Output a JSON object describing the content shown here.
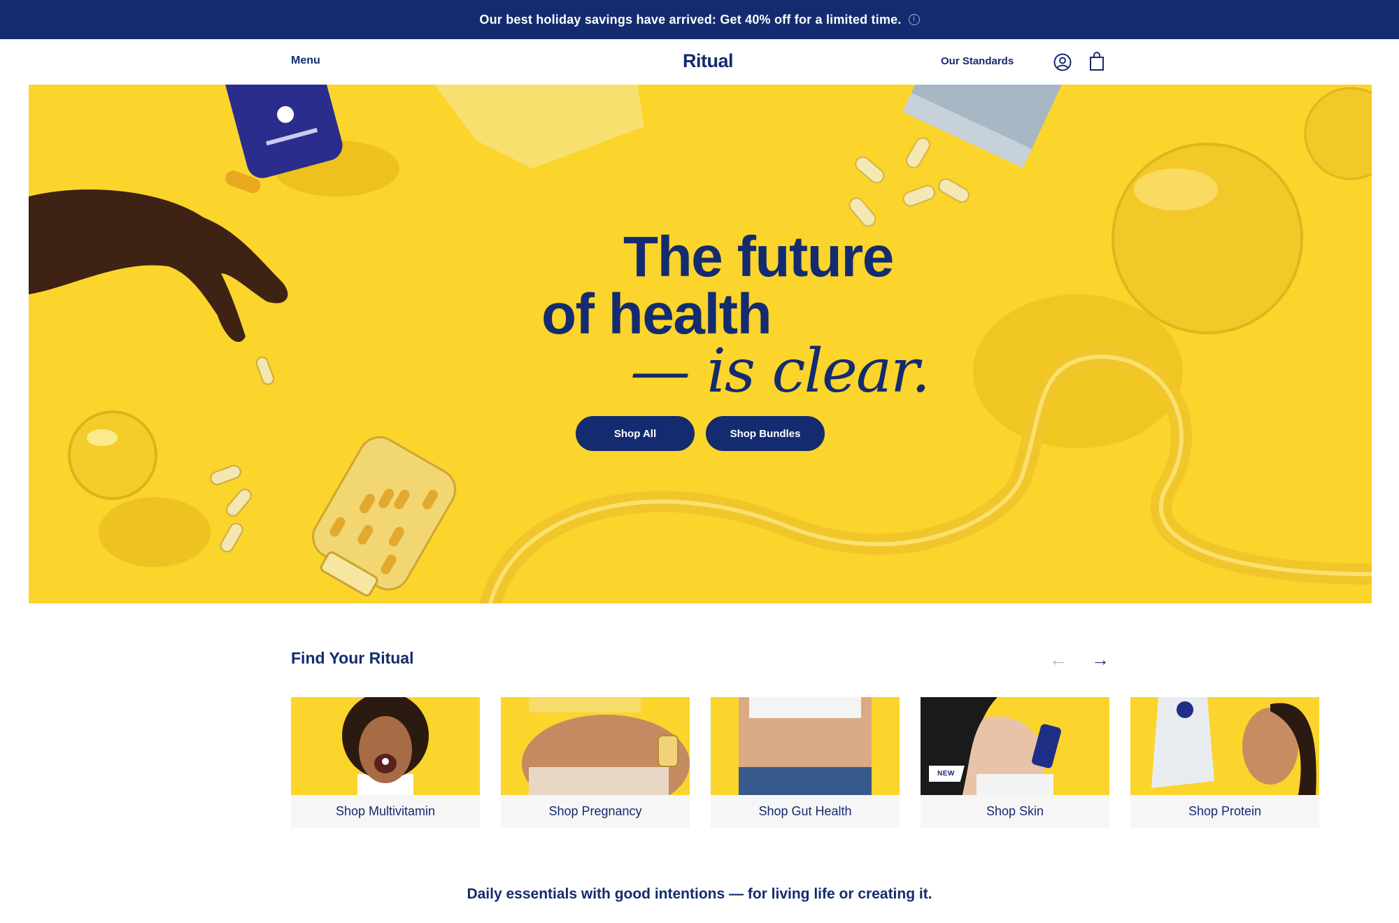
{
  "promo": {
    "text": "Our best holiday savings have arrived: Get 40% off for a limited time.",
    "info_icon": "i"
  },
  "nav": {
    "menu_label": "Menu",
    "logo": "Ritual",
    "standards_label": "Our Standards",
    "account_icon": "account-icon",
    "cart_icon": "cart-icon"
  },
  "hero": {
    "line1": "The future",
    "line2": "of health",
    "line3": "— is clear.",
    "shop_all": "Shop All",
    "shop_bundles": "Shop Bundles",
    "background_color": "#fbd42c"
  },
  "find": {
    "title": "Find Your Ritual",
    "prev_arrow": "←",
    "next_arrow": "→",
    "cards": [
      {
        "label": "Shop Multivitamin"
      },
      {
        "label": "Shop Pregnancy"
      },
      {
        "label": "Shop Gut Health"
      },
      {
        "label": "Shop Skin",
        "badge": "NEW"
      },
      {
        "label": "Shop Protein"
      }
    ]
  },
  "tagline": "Daily essentials with good intentions — for living life or creating it.",
  "colors": {
    "brand_navy": "#142b6f",
    "brand_yellow": "#fbd42c"
  }
}
